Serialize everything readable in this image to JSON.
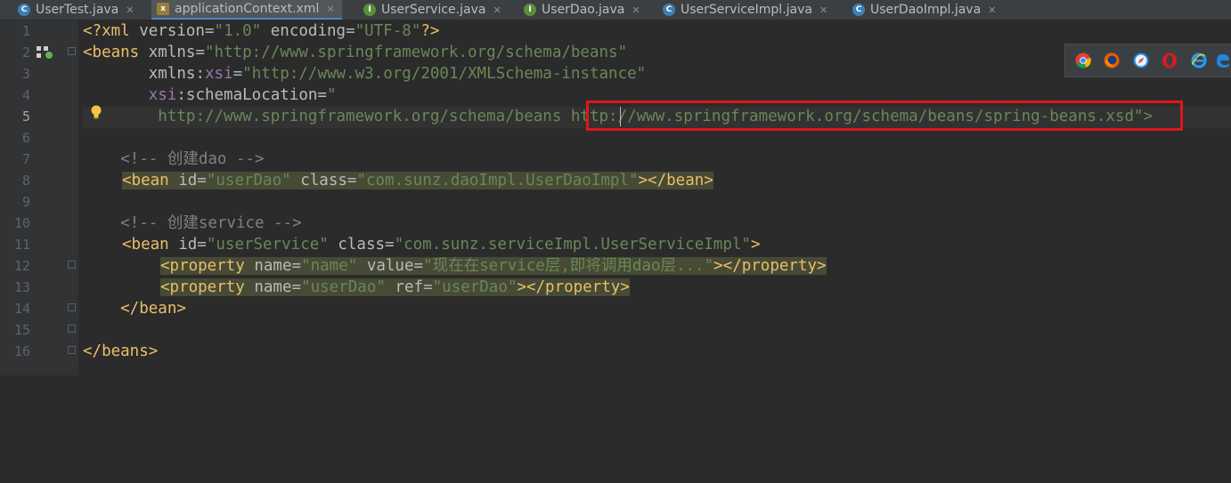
{
  "tabs": [
    {
      "label": "UserTest.java",
      "icon": "class-icon"
    },
    {
      "label": "applicationContext.xml",
      "icon": "xml-icon",
      "active": true
    },
    {
      "label": "UserService.java",
      "icon": "interface-icon"
    },
    {
      "label": "UserDao.java",
      "icon": "interface-icon"
    },
    {
      "label": "UserServiceImpl.java",
      "icon": "class-icon"
    },
    {
      "label": "UserDaoImpl.java",
      "icon": "class-icon"
    }
  ],
  "line_numbers": [
    "1",
    "2",
    "3",
    "4",
    "5",
    "6",
    "7",
    "8",
    "9",
    "10",
    "11",
    "12",
    "13",
    "14",
    "15",
    "16"
  ],
  "code": {
    "l1": {
      "a": "<?xml ",
      "b": "version",
      "c": "=",
      "d": "\"1.0\"",
      "e": " ",
      "f": "encoding",
      "g": "=",
      "h": "\"UTF-8\"",
      "i": "?>"
    },
    "l2": {
      "a": "<beans ",
      "b": "xmlns",
      "c": "=",
      "d": "\"http://www.springframework.org/schema/beans\""
    },
    "l3": {
      "a": "       ",
      "b": "xmlns",
      "c": ":",
      "d": "xsi",
      "e": "=",
      "f": "\"http://www.w3.org/2001/XMLSchema-instance\""
    },
    "l4": {
      "a": "       ",
      "b": "xsi",
      "c": ":schemaLocation=",
      "d": "\""
    },
    "l5": {
      "a": "        ",
      "b": "http://www.springframework.org/schema/beans http://www.springframework.org/schema/beans/spring-beans.xsd",
      "c": "\">"
    },
    "l7": {
      "a": "    <!-- 创建dao -->"
    },
    "l8": {
      "a": "<bean ",
      "b": "id",
      "c": "=",
      "d": "\"userDao\"",
      "e": " class",
      "f": "=",
      "g": "\"com.sunz.daoImpl.UserDaoImpl\"",
      "h": "></bean>"
    },
    "l10": {
      "a": "    <!-- 创建service -->"
    },
    "l11": {
      "a": "<bean ",
      "b": "id",
      "c": "=",
      "d": "\"userService\"",
      "e": " class",
      "f": "=",
      "g": "\"com.sunz.serviceImpl.UserServiceImpl\"",
      "h": ">"
    },
    "l12": {
      "a": "<property ",
      "b": "name",
      "c": "=",
      "d": "\"name\"",
      "e": " value",
      "f": "=",
      "g": "\"现在在service层,即将调用dao层...\"",
      "h": "></property>"
    },
    "l13": {
      "a": "<property ",
      "b": "name",
      "c": "=",
      "d": "\"userDao\"",
      "e": " ref",
      "f": "=",
      "g": "\"userDao\"",
      "h": "></property>"
    },
    "l14": {
      "a": "    </bean>"
    },
    "l16": {
      "a": "</beans>"
    }
  },
  "colors": {
    "tag": "#e8bf6a",
    "attr": "#bababa",
    "string": "#6a8759",
    "comment": "#808080",
    "namespace": "#9876aa",
    "highlight_box": "#e0161c"
  },
  "browsers": [
    "chrome-icon",
    "firefox-icon",
    "safari-icon",
    "opera-icon",
    "ie-icon",
    "edge-icon"
  ]
}
